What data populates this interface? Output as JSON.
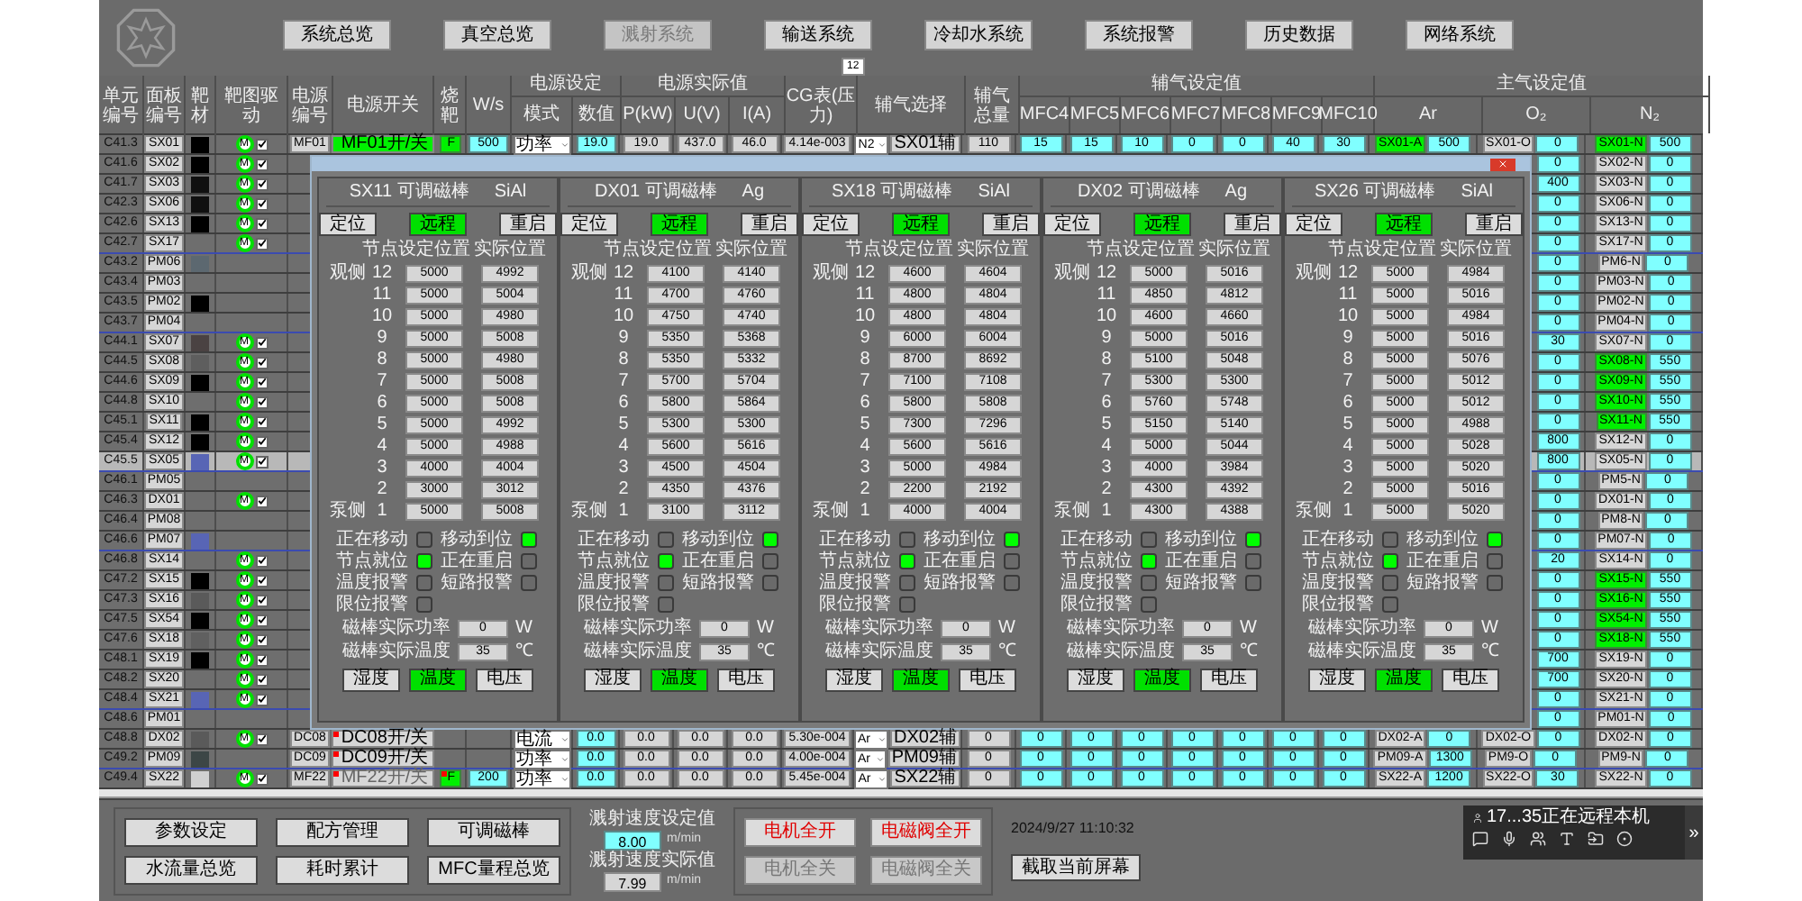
{
  "header": {
    "nav": [
      {
        "label": "系统总览",
        "disabled": false
      },
      {
        "label": "真空总览",
        "disabled": false
      },
      {
        "label": "溅射系统",
        "disabled": true
      },
      {
        "label": "输送系统",
        "disabled": false
      },
      {
        "label": "冷却水系统",
        "disabled": false
      },
      {
        "label": "系统报警",
        "disabled": false
      },
      {
        "label": "历史数据",
        "disabled": false
      },
      {
        "label": "网络系统",
        "disabled": false
      }
    ],
    "badge": "12"
  },
  "table": {
    "columns": [
      "单元编号",
      "面板编号",
      "靶材",
      "靶图驱动",
      "电源编号",
      "电源开关",
      "烧靶",
      "W/s",
      "模式",
      "数值",
      "P(kW)",
      "U(V)",
      "I(A)",
      "CG表(压力)",
      "辅气选择",
      "辅气总量",
      "MFC4",
      "MFC5",
      "MFC6",
      "MFC7",
      "MFC8",
      "MFC9",
      "MFC10",
      "Ar",
      "O₂",
      "N₂"
    ],
    "groups": [
      {
        "label": "电源设定"
      },
      {
        "label": "电源实际值"
      },
      {
        "label": "辅气设定值"
      },
      {
        "label": "主气设定值"
      }
    ],
    "rows": [
      {
        "kind": "full",
        "unit": "C41.3",
        "panel": "SX01",
        "color": "#000000",
        "motor": {
          "label": "M",
          "checked": true
        },
        "power": "MF01",
        "switch": {
          "label": "MF01开/关",
          "on": true,
          "disabled": false
        },
        "burn": {
          "label": "F",
          "alarm": false
        },
        "ws": "500",
        "mode": "功率",
        "value": "19.0",
        "p": "19.0",
        "u": "437.0",
        "i": "46.0",
        "cg": "4.14e-003",
        "gas": "N2",
        "gas_name": "SX01辅",
        "gas_total": "110",
        "mfc": [
          "15",
          "15",
          "10",
          "0",
          "0",
          "40",
          "30"
        ],
        "ar": {
          "name": "SX01-A",
          "on": true,
          "value": "500"
        },
        "o2": {
          "name": "SX01-O",
          "value": "0"
        },
        "n2": {
          "name": "SX01-N",
          "on": true,
          "value": "500"
        },
        "separator": false,
        "selected": false
      },
      {
        "kind": "partial",
        "unit": "C41.6",
        "panel": "SX02",
        "color": "#000000",
        "motor": {
          "label": "M",
          "checked": true
        },
        "o2": "0",
        "n2": {
          "name": "SX02-N",
          "on": false,
          "value": "0"
        },
        "separator": false,
        "selected": false
      },
      {
        "kind": "partial",
        "unit": "C41.7",
        "panel": "SX03",
        "color": "#101010",
        "motor": {
          "label": "M",
          "checked": true
        },
        "o2": "400",
        "n2": {
          "name": "SX03-N",
          "on": false,
          "value": "0"
        },
        "separator": false,
        "selected": false
      },
      {
        "kind": "partial",
        "unit": "C42.3",
        "panel": "SX06",
        "color": "#101010",
        "motor": {
          "label": "M",
          "checked": true
        },
        "o2": "0",
        "n2": {
          "name": "SX06-N",
          "on": false,
          "value": "0"
        },
        "separator": false,
        "selected": false
      },
      {
        "kind": "partial",
        "unit": "C42.6",
        "panel": "SX13",
        "color": "#000000",
        "motor": {
          "label": "M",
          "checked": true
        },
        "o2": "0",
        "n2": {
          "name": "SX13-N",
          "on": false,
          "value": "0"
        },
        "separator": false,
        "selected": false
      },
      {
        "kind": "partial",
        "unit": "C42.7",
        "panel": "SX17",
        "motor": {
          "label": "M",
          "checked": true
        },
        "o2": "0",
        "n2": {
          "name": "SX17-N",
          "on": false,
          "value": "0"
        },
        "separator": true,
        "selected": false
      },
      {
        "kind": "partial",
        "unit": "C43.2",
        "panel": "PM06",
        "color": "#5c6870",
        "o2": "0",
        "n2": {
          "name": "PM6-N",
          "on": false,
          "value": "0"
        },
        "separator": false,
        "selected": false
      },
      {
        "kind": "partial",
        "unit": "C43.4",
        "panel": "PM03",
        "o2": "0",
        "n2": {
          "name": "PM03-N",
          "on": false,
          "value": "0"
        },
        "separator": false,
        "selected": false
      },
      {
        "kind": "partial",
        "unit": "C43.5",
        "panel": "PM02",
        "color": "#000000",
        "o2": "0",
        "n2": {
          "name": "PM02-N",
          "on": false,
          "value": "0"
        },
        "separator": false,
        "selected": false
      },
      {
        "kind": "partial",
        "unit": "C43.7",
        "panel": "PM04",
        "o2": "0",
        "n2": {
          "name": "PM04-N",
          "on": false,
          "value": "0"
        },
        "separator": true,
        "selected": false
      },
      {
        "kind": "partial",
        "unit": "C44.1",
        "panel": "SX07",
        "color": "#4a4242",
        "motor": {
          "label": "M",
          "checked": true
        },
        "o2": "30",
        "n2": {
          "name": "SX07-N",
          "on": false,
          "value": "0"
        },
        "separator": false,
        "selected": false
      },
      {
        "kind": "partial",
        "unit": "C44.5",
        "panel": "SX08",
        "color": "#5e5e5e",
        "motor": {
          "label": "M",
          "checked": true
        },
        "o2": "0",
        "n2": {
          "name": "SX08-N",
          "on": true,
          "value": "550"
        },
        "separator": false,
        "selected": false
      },
      {
        "kind": "partial",
        "unit": "C44.6",
        "panel": "SX09",
        "color": "#000000",
        "motor": {
          "label": "M",
          "checked": true
        },
        "o2": "0",
        "n2": {
          "name": "SX09-N",
          "on": true,
          "value": "550"
        },
        "separator": false,
        "selected": false
      },
      {
        "kind": "partial",
        "unit": "C44.8",
        "panel": "SX10",
        "motor": {
          "label": "M",
          "checked": true
        },
        "o2": "0",
        "n2": {
          "name": "SX10-N",
          "on": true,
          "value": "550"
        },
        "separator": false,
        "selected": false
      },
      {
        "kind": "partial",
        "unit": "C45.1",
        "panel": "SX11",
        "color": "#000000",
        "motor": {
          "label": "M",
          "checked": true
        },
        "o2": "0",
        "n2": {
          "name": "SX11-N",
          "on": true,
          "value": "550"
        },
        "separator": false,
        "selected": false
      },
      {
        "kind": "partial",
        "unit": "C45.4",
        "panel": "SX12",
        "color": "#000000",
        "motor": {
          "label": "M",
          "checked": true
        },
        "o2": "800",
        "n2": {
          "name": "SX12-N",
          "on": false,
          "value": "0"
        },
        "separator": false,
        "selected": false
      },
      {
        "kind": "partial",
        "unit": "C45.5",
        "panel": "SX05",
        "color": "#5865b5",
        "motor": {
          "label": "M",
          "checked": true
        },
        "o2": "800",
        "n2": {
          "name": "SX05-N",
          "on": false,
          "value": "0"
        },
        "separator": true,
        "selected": true
      },
      {
        "kind": "partial",
        "unit": "C46.1",
        "panel": "PM05",
        "o2": "0",
        "n2": {
          "name": "PM5-N",
          "on": false,
          "value": "0"
        },
        "separator": false,
        "selected": false
      },
      {
        "kind": "partial",
        "unit": "C46.3",
        "panel": "DX01",
        "motor": {
          "label": "M",
          "checked": true
        },
        "o2": "0",
        "n2": {
          "name": "DX01-N",
          "on": false,
          "value": "0"
        },
        "separator": false,
        "selected": false
      },
      {
        "kind": "partial",
        "unit": "C46.4",
        "panel": "PM08",
        "o2": "0",
        "n2": {
          "name": "PM8-N",
          "on": false,
          "value": "0"
        },
        "separator": false,
        "selected": false
      },
      {
        "kind": "partial",
        "unit": "C46.6",
        "panel": "PM07",
        "color": "#5865b5",
        "o2": "0",
        "n2": {
          "name": "PM07-N",
          "on": false,
          "value": "0"
        },
        "separator": true,
        "selected": false
      },
      {
        "kind": "partial",
        "unit": "C46.8",
        "panel": "SX14",
        "motor": {
          "label": "M",
          "checked": true
        },
        "o2": "20",
        "n2": {
          "name": "SX14-N",
          "on": false,
          "value": "0"
        },
        "separator": false,
        "selected": false
      },
      {
        "kind": "partial",
        "unit": "C47.2",
        "panel": "SX15",
        "color": "#000000",
        "motor": {
          "label": "M",
          "checked": true
        },
        "o2": "0",
        "n2": {
          "name": "SX15-N",
          "on": true,
          "value": "550"
        },
        "separator": false,
        "selected": false
      },
      {
        "kind": "partial",
        "unit": "C47.3",
        "panel": "SX16",
        "color": "#5a5a5a",
        "motor": {
          "label": "M",
          "checked": true
        },
        "o2": "0",
        "n2": {
          "name": "SX16-N",
          "on": true,
          "value": "550"
        },
        "separator": false,
        "selected": false
      },
      {
        "kind": "partial",
        "unit": "C47.5",
        "panel": "SX54",
        "color": "#000000",
        "motor": {
          "label": "M",
          "checked": true
        },
        "o2": "0",
        "n2": {
          "name": "SX54-N",
          "on": true,
          "value": "550"
        },
        "separator": false,
        "selected": false
      },
      {
        "kind": "partial",
        "unit": "C47.6",
        "panel": "SX18",
        "color": "#606060",
        "motor": {
          "label": "M",
          "checked": true
        },
        "o2": "0",
        "n2": {
          "name": "SX18-N",
          "on": true,
          "value": "550"
        },
        "separator": false,
        "selected": false
      },
      {
        "kind": "partial",
        "unit": "C48.1",
        "panel": "SX19",
        "color": "#000000",
        "motor": {
          "label": "M",
          "checked": true
        },
        "o2": "700",
        "n2": {
          "name": "SX19-N",
          "on": false,
          "value": "0"
        },
        "separator": false,
        "selected": false
      },
      {
        "kind": "partial",
        "unit": "C48.2",
        "panel": "SX20",
        "motor": {
          "label": "M",
          "checked": true
        },
        "o2": "700",
        "n2": {
          "name": "SX20-N",
          "on": false,
          "value": "0"
        },
        "separator": false,
        "selected": false
      },
      {
        "kind": "partial",
        "unit": "C48.4",
        "panel": "SX21",
        "color": "#5865b5",
        "motor": {
          "label": "M",
          "checked": true
        },
        "o2": "0",
        "n2": {
          "name": "SX21-N",
          "on": false,
          "value": "0"
        },
        "separator": true,
        "selected": false
      },
      {
        "kind": "partial",
        "unit": "C48.6",
        "panel": "PM01",
        "o2": "0",
        "n2": {
          "name": "PM01-N",
          "on": false,
          "value": "0"
        },
        "separator": false,
        "selected": false
      },
      {
        "kind": "full",
        "unit": "C48.8",
        "panel": "DX02",
        "color": "#5a5a5a",
        "motor": {
          "label": "M",
          "checked": true
        },
        "power": "DC08",
        "switch": {
          "label": "DC08开/关",
          "on": false,
          "disabled": false
        },
        "mode": "电流",
        "value": "0.0",
        "p": "0.0",
        "u": "0.0",
        "i": "0.0",
        "cg": "5.30e-004",
        "gas": "Ar",
        "gas_name": "DX02辅",
        "gas_total": "0",
        "mfc": [
          "0",
          "0",
          "0",
          "0",
          "0",
          "0",
          "0"
        ],
        "ar": {
          "name": "DX02-A",
          "on": false,
          "value": "0"
        },
        "o2": {
          "name": "DX02-O",
          "value": "0"
        },
        "n2": {
          "name": "DX02-N",
          "on": false,
          "value": "0"
        },
        "separator": false,
        "selected": false
      },
      {
        "kind": "full",
        "unit": "C49.2",
        "panel": "PM09",
        "color": "#3c4646",
        "power": "DC09",
        "switch": {
          "label": "DC09开/关",
          "on": false,
          "disabled": false
        },
        "mode": "功率",
        "value": "0.0",
        "p": "0.0",
        "u": "0.0",
        "i": "0.0",
        "cg": "4.00e-004",
        "gas": "Ar",
        "gas_name": "PM09辅",
        "gas_total": "0",
        "mfc": [
          "0",
          "0",
          "0",
          "0",
          "0",
          "0",
          "0"
        ],
        "ar": {
          "name": "PM09-A",
          "on": false,
          "value": "1300"
        },
        "o2": {
          "name": "PM9-O",
          "value": "0"
        },
        "n2": {
          "name": "PM9-N",
          "on": false,
          "value": "0"
        },
        "separator": true,
        "selected": false
      },
      {
        "kind": "full",
        "unit": "C49.4",
        "panel": "SX22",
        "color": "#d0d0d0",
        "motor": {
          "label": "M",
          "checked": true
        },
        "power": "MF22",
        "switch": {
          "label": "MF22开/关",
          "on": false,
          "disabled": true
        },
        "burn": {
          "label": "F",
          "alarm": true
        },
        "ws": "200",
        "mode": "功率",
        "value": "0.0",
        "p": "0.0",
        "u": "0.0",
        "i": "0.0",
        "cg": "5.45e-004",
        "gas": "Ar",
        "gas_name": "SX22辅",
        "gas_total": "0",
        "mfc": [
          "0",
          "0",
          "0",
          "0",
          "0",
          "0",
          "0"
        ],
        "ar": {
          "name": "SX22-A",
          "on": false,
          "value": "1200"
        },
        "o2": {
          "name": "SX22-O",
          "value": "30"
        },
        "n2": {
          "name": "SX22-N",
          "on": false,
          "value": "0"
        },
        "separator": false,
        "selected": false
      }
    ]
  },
  "dialog": {
    "panels": [
      {
        "name": "SX11 可调磁棒",
        "material": "SiAl",
        "buttons": [
          {
            "label": "定位",
            "selected": false
          },
          {
            "label": "远程",
            "selected": true
          },
          {
            "label": "重启",
            "selected": false
          }
        ],
        "headers": [
          "节点",
          "设定位置",
          "实际位置"
        ],
        "top_side": "观侧",
        "bottom_side": "泵侧",
        "nodes": [
          {
            "node": "12",
            "set": "5000",
            "actual": "4992"
          },
          {
            "node": "11",
            "set": "5000",
            "actual": "5004"
          },
          {
            "node": "10",
            "set": "5000",
            "actual": "4980"
          },
          {
            "node": "9",
            "set": "5000",
            "actual": "5008"
          },
          {
            "node": "8",
            "set": "5000",
            "actual": "4980"
          },
          {
            "node": "7",
            "set": "5000",
            "actual": "5008"
          },
          {
            "node": "6",
            "set": "5000",
            "actual": "5008"
          },
          {
            "node": "5",
            "set": "5000",
            "actual": "4992"
          },
          {
            "node": "4",
            "set": "5000",
            "actual": "4988"
          },
          {
            "node": "3",
            "set": "4000",
            "actual": "4004"
          },
          {
            "node": "2",
            "set": "3000",
            "actual": "3012"
          },
          {
            "node": "1",
            "set": "5000",
            "actual": "5008"
          }
        ],
        "indicators": [
          {
            "label": "正在移动",
            "on": false
          },
          {
            "label": "移动到位",
            "on": true
          },
          {
            "label": "节点就位",
            "on": true
          },
          {
            "label": "正在重启",
            "on": false
          },
          {
            "label": "温度报警",
            "on": false
          },
          {
            "label": "短路报警",
            "on": false
          },
          {
            "label": "限位报警",
            "on": false
          }
        ],
        "readings": [
          {
            "label": "磁棒实际功率",
            "value": "0",
            "unit": "W"
          },
          {
            "label": "磁棒实际温度",
            "value": "35",
            "unit": "℃"
          }
        ],
        "modes": [
          {
            "label": "湿度",
            "selected": false
          },
          {
            "label": "温度",
            "selected": true
          },
          {
            "label": "电压",
            "selected": false
          }
        ]
      },
      {
        "name": "DX01 可调磁棒",
        "material": "Ag",
        "buttons": [
          {
            "label": "定位",
            "selected": false
          },
          {
            "label": "远程",
            "selected": true
          },
          {
            "label": "重启",
            "selected": false
          }
        ],
        "headers": [
          "节点",
          "设定位置",
          "实际位置"
        ],
        "top_side": "观侧",
        "bottom_side": "泵侧",
        "nodes": [
          {
            "node": "12",
            "set": "4100",
            "actual": "4140"
          },
          {
            "node": "11",
            "set": "4700",
            "actual": "4760"
          },
          {
            "node": "10",
            "set": "4750",
            "actual": "4740"
          },
          {
            "node": "9",
            "set": "5350",
            "actual": "5368"
          },
          {
            "node": "8",
            "set": "5350",
            "actual": "5332"
          },
          {
            "node": "7",
            "set": "5700",
            "actual": "5704"
          },
          {
            "node": "6",
            "set": "5800",
            "actual": "5864"
          },
          {
            "node": "5",
            "set": "5300",
            "actual": "5300"
          },
          {
            "node": "4",
            "set": "5600",
            "actual": "5616"
          },
          {
            "node": "3",
            "set": "4500",
            "actual": "4504"
          },
          {
            "node": "2",
            "set": "4350",
            "actual": "4376"
          },
          {
            "node": "1",
            "set": "3100",
            "actual": "3112"
          }
        ],
        "indicators": [
          {
            "label": "正在移动",
            "on": false
          },
          {
            "label": "移动到位",
            "on": true
          },
          {
            "label": "节点就位",
            "on": true
          },
          {
            "label": "正在重启",
            "on": false
          },
          {
            "label": "温度报警",
            "on": false
          },
          {
            "label": "短路报警",
            "on": false
          },
          {
            "label": "限位报警",
            "on": false
          }
        ],
        "readings": [
          {
            "label": "磁棒实际功率",
            "value": "0",
            "unit": "W"
          },
          {
            "label": "磁棒实际温度",
            "value": "35",
            "unit": "℃"
          }
        ],
        "modes": [
          {
            "label": "湿度",
            "selected": false
          },
          {
            "label": "温度",
            "selected": true
          },
          {
            "label": "电压",
            "selected": false
          }
        ]
      },
      {
        "name": "SX18 可调磁棒",
        "material": "SiAl",
        "buttons": [
          {
            "label": "定位",
            "selected": false
          },
          {
            "label": "远程",
            "selected": true
          },
          {
            "label": "重启",
            "selected": false
          }
        ],
        "headers": [
          "节点",
          "设定位置",
          "实际位置"
        ],
        "top_side": "观侧",
        "bottom_side": "泵侧",
        "nodes": [
          {
            "node": "12",
            "set": "4600",
            "actual": "4604"
          },
          {
            "node": "11",
            "set": "4800",
            "actual": "4804"
          },
          {
            "node": "10",
            "set": "4800",
            "actual": "4804"
          },
          {
            "node": "9",
            "set": "6000",
            "actual": "6004"
          },
          {
            "node": "8",
            "set": "8700",
            "actual": "8692"
          },
          {
            "node": "7",
            "set": "7100",
            "actual": "7108"
          },
          {
            "node": "6",
            "set": "5800",
            "actual": "5808"
          },
          {
            "node": "5",
            "set": "7300",
            "actual": "7296"
          },
          {
            "node": "4",
            "set": "5600",
            "actual": "5616"
          },
          {
            "node": "3",
            "set": "5000",
            "actual": "4984"
          },
          {
            "node": "2",
            "set": "2200",
            "actual": "2192"
          },
          {
            "node": "1",
            "set": "4000",
            "actual": "4004"
          }
        ],
        "indicators": [
          {
            "label": "正在移动",
            "on": false
          },
          {
            "label": "移动到位",
            "on": true
          },
          {
            "label": "节点就位",
            "on": true
          },
          {
            "label": "正在重启",
            "on": false
          },
          {
            "label": "温度报警",
            "on": false
          },
          {
            "label": "短路报警",
            "on": false
          },
          {
            "label": "限位报警",
            "on": false
          }
        ],
        "readings": [
          {
            "label": "磁棒实际功率",
            "value": "0",
            "unit": "W"
          },
          {
            "label": "磁棒实际温度",
            "value": "35",
            "unit": "℃"
          }
        ],
        "modes": [
          {
            "label": "湿度",
            "selected": false
          },
          {
            "label": "温度",
            "selected": true
          },
          {
            "label": "电压",
            "selected": false
          }
        ]
      },
      {
        "name": "DX02 可调磁棒",
        "material": "Ag",
        "buttons": [
          {
            "label": "定位",
            "selected": false
          },
          {
            "label": "远程",
            "selected": true
          },
          {
            "label": "重启",
            "selected": false
          }
        ],
        "headers": [
          "节点",
          "设定位置",
          "实际位置"
        ],
        "top_side": "观侧",
        "bottom_side": "泵侧",
        "nodes": [
          {
            "node": "12",
            "set": "5000",
            "actual": "5016"
          },
          {
            "node": "11",
            "set": "4850",
            "actual": "4812"
          },
          {
            "node": "10",
            "set": "4600",
            "actual": "4660"
          },
          {
            "node": "9",
            "set": "5000",
            "actual": "5016"
          },
          {
            "node": "8",
            "set": "5100",
            "actual": "5048"
          },
          {
            "node": "7",
            "set": "5300",
            "actual": "5300"
          },
          {
            "node": "6",
            "set": "5760",
            "actual": "5748"
          },
          {
            "node": "5",
            "set": "5150",
            "actual": "5140"
          },
          {
            "node": "4",
            "set": "5000",
            "actual": "5044"
          },
          {
            "node": "3",
            "set": "4000",
            "actual": "3984"
          },
          {
            "node": "2",
            "set": "4300",
            "actual": "4392"
          },
          {
            "node": "1",
            "set": "4300",
            "actual": "4388"
          }
        ],
        "indicators": [
          {
            "label": "正在移动",
            "on": false
          },
          {
            "label": "移动到位",
            "on": true
          },
          {
            "label": "节点就位",
            "on": true
          },
          {
            "label": "正在重启",
            "on": false
          },
          {
            "label": "温度报警",
            "on": false
          },
          {
            "label": "短路报警",
            "on": false
          },
          {
            "label": "限位报警",
            "on": false
          }
        ],
        "readings": [
          {
            "label": "磁棒实际功率",
            "value": "0",
            "unit": "W"
          },
          {
            "label": "磁棒实际温度",
            "value": "35",
            "unit": "℃"
          }
        ],
        "modes": [
          {
            "label": "湿度",
            "selected": false
          },
          {
            "label": "温度",
            "selected": true
          },
          {
            "label": "电压",
            "selected": false
          }
        ]
      },
      {
        "name": "SX26 可调磁棒",
        "material": "SiAl",
        "buttons": [
          {
            "label": "定位",
            "selected": false
          },
          {
            "label": "远程",
            "selected": true
          },
          {
            "label": "重启",
            "selected": false
          }
        ],
        "headers": [
          "节点",
          "设定位置",
          "实际位置"
        ],
        "top_side": "观侧",
        "bottom_side": "泵侧",
        "nodes": [
          {
            "node": "12",
            "set": "5000",
            "actual": "4984"
          },
          {
            "node": "11",
            "set": "5000",
            "actual": "5016"
          },
          {
            "node": "10",
            "set": "5000",
            "actual": "4984"
          },
          {
            "node": "9",
            "set": "5000",
            "actual": "5016"
          },
          {
            "node": "8",
            "set": "5000",
            "actual": "5076"
          },
          {
            "node": "7",
            "set": "5000",
            "actual": "5012"
          },
          {
            "node": "6",
            "set": "5000",
            "actual": "5012"
          },
          {
            "node": "5",
            "set": "5000",
            "actual": "4988"
          },
          {
            "node": "4",
            "set": "5000",
            "actual": "5028"
          },
          {
            "node": "3",
            "set": "5000",
            "actual": "5020"
          },
          {
            "node": "2",
            "set": "5000",
            "actual": "5016"
          },
          {
            "node": "1",
            "set": "5000",
            "actual": "5020"
          }
        ],
        "indicators": [
          {
            "label": "正在移动",
            "on": false
          },
          {
            "label": "移动到位",
            "on": true
          },
          {
            "label": "节点就位",
            "on": true
          },
          {
            "label": "正在重启",
            "on": false
          },
          {
            "label": "温度报警",
            "on": false
          },
          {
            "label": "短路报警",
            "on": false
          },
          {
            "label": "限位报警",
            "on": false
          }
        ],
        "readings": [
          {
            "label": "磁棒实际功率",
            "value": "0",
            "unit": "W"
          },
          {
            "label": "磁棒实际温度",
            "value": "35",
            "unit": "℃"
          }
        ],
        "modes": [
          {
            "label": "湿度",
            "selected": false
          },
          {
            "label": "温度",
            "selected": true
          },
          {
            "label": "电压",
            "selected": false
          }
        ]
      }
    ]
  },
  "footer": {
    "menu": [
      "参数设定",
      "配方管理",
      "可调磁棒",
      "水流量总览",
      "耗时累计",
      "MFC量程总览"
    ],
    "speeds": [
      {
        "label": "溅射速度设定值",
        "value": "8.00",
        "unit": "m/min",
        "kind": "input"
      },
      {
        "label": "溅射速度实际值",
        "value": "7.99",
        "unit": "m/min",
        "kind": "readout"
      }
    ],
    "controls": [
      {
        "label": "电机全开",
        "disabled": false
      },
      {
        "label": "电磁阀全开",
        "disabled": false
      },
      {
        "label": "电机全关",
        "disabled": true
      },
      {
        "label": "电磁阀全关",
        "disabled": true
      }
    ],
    "datetime": "2024/9/27 11:10:32",
    "capture": "截取当前屏幕"
  },
  "remote": {
    "text": "17...35正在远程本机",
    "expand": "»"
  }
}
